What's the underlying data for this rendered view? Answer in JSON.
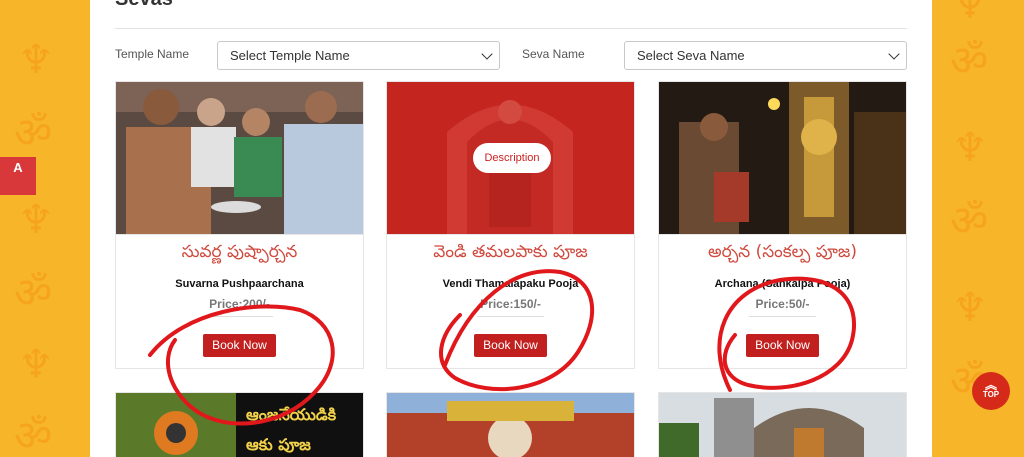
{
  "page": {
    "heading": "Sevas"
  },
  "accessibility": {
    "label": "A"
  },
  "filters": {
    "temple_label": "Temple Name",
    "temple_value": "Select Temple Name",
    "seva_label": "Seva Name",
    "seva_value": "Select Seva Name"
  },
  "cards": [
    {
      "telugu": "సువర్ణ పుష్పార్చన",
      "english": "Suvarna Pushpaarchana",
      "price": "Price:200/-",
      "book": "Book Now"
    },
    {
      "telugu": "వెండి తమలపాకు పూజ",
      "english": "Vendi Thamalapaku Pooja",
      "price": "Price:150/-",
      "book": "Book Now",
      "description": "Description"
    },
    {
      "telugu": "అర్చన (సంకల్ప పూజ)",
      "english": "Archana (Sankalpa Pooja)",
      "price": "Price:50/-",
      "book": "Book Now"
    }
  ],
  "second_row": [
    {
      "caption_line1": "ఆంజనేయుడికి",
      "caption_line2": "ఆకు పూజ"
    }
  ],
  "scroll_top": {
    "label": "TOP"
  },
  "colors": {
    "page_bg": "#f7b52a",
    "accent_red": "#c21f1f",
    "telugu_text": "#d04a3e",
    "annotation_red": "#e0181c"
  }
}
